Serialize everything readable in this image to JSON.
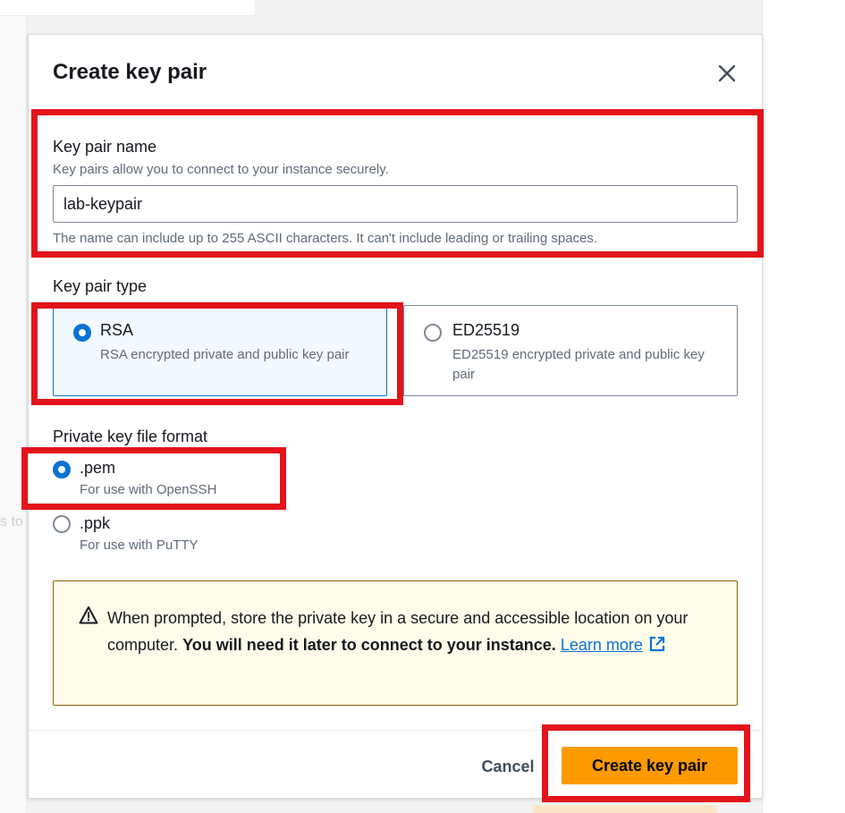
{
  "background": {
    "partial_text": "s to"
  },
  "modal": {
    "title": "Create key pair",
    "close_icon": "close-icon",
    "key_pair_name": {
      "label": "Key pair name",
      "description": "Key pairs allow you to connect to your instance securely.",
      "value": "lab-keypair",
      "constraint": "The name can include up to 255 ASCII characters. It can't include leading or trailing spaces."
    },
    "key_pair_type": {
      "label": "Key pair type",
      "options": [
        {
          "title": "RSA",
          "description": "RSA encrypted private and public key pair",
          "selected": true
        },
        {
          "title": "ED25519",
          "description": "ED25519 encrypted private and public key pair",
          "selected": false
        }
      ]
    },
    "private_key_format": {
      "label": "Private key file format",
      "options": [
        {
          "title": ".pem",
          "description": "For use with OpenSSH",
          "selected": true
        },
        {
          "title": ".ppk",
          "description": "For use with PuTTY",
          "selected": false
        }
      ]
    },
    "warning": {
      "icon": "warning-icon",
      "text_plain": "When prompted, store the private key in a secure and accessible location on your computer.",
      "text_bold": "You will need it later to connect to your instance.",
      "link_label": "Learn more",
      "link_icon": "external-link-icon"
    },
    "footer": {
      "cancel_label": "Cancel",
      "create_label": "Create key pair"
    }
  },
  "colors": {
    "accent": "#0972d3",
    "primary_button": "#ff9900",
    "annotation_red": "#e3141b",
    "warning_bg": "#fffce9",
    "warning_border": "#8d6605"
  }
}
